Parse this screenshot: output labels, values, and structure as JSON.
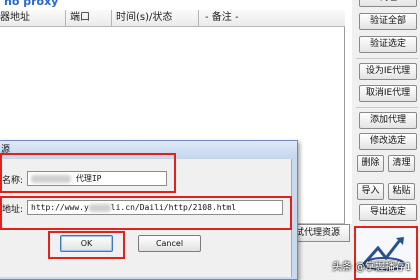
{
  "window": {
    "title_fragment": "no proxy"
  },
  "list": {
    "columns": [
      "器地址",
      "端口",
      "时间(s)/状态",
      "- 备注 -"
    ]
  },
  "right_buttons": {
    "top_cut": "代理",
    "verify_all": "验证全部",
    "verify_selected": "验证选定",
    "set_ie_proxy": "设为IE代理",
    "cancel_ie_proxy": "取消IE代理",
    "add_proxy": "添加代理",
    "edit_selected": "修改选定",
    "delete": "删除",
    "clear": "清理",
    "import": "导入",
    "paste": "粘贴",
    "export_selected": "导出选定"
  },
  "extra_tab": {
    "label": "试代理资源"
  },
  "dialog": {
    "title_fragment": "源",
    "name_label": "名称:",
    "name_value_suffix": "代理IP",
    "address_label": "地址:",
    "address_prefix": "http://www.y",
    "address_suffix": "li.cn/Daili/http/2108.html",
    "ok_label": "OK",
    "cancel_label": "Cancel"
  },
  "watermark": {
    "text": "头条 @掌握播存1"
  },
  "colors": {
    "highlight": "#e0221c",
    "title_text": "#2b67c9",
    "dialog_frame": "#c9d9ee"
  }
}
